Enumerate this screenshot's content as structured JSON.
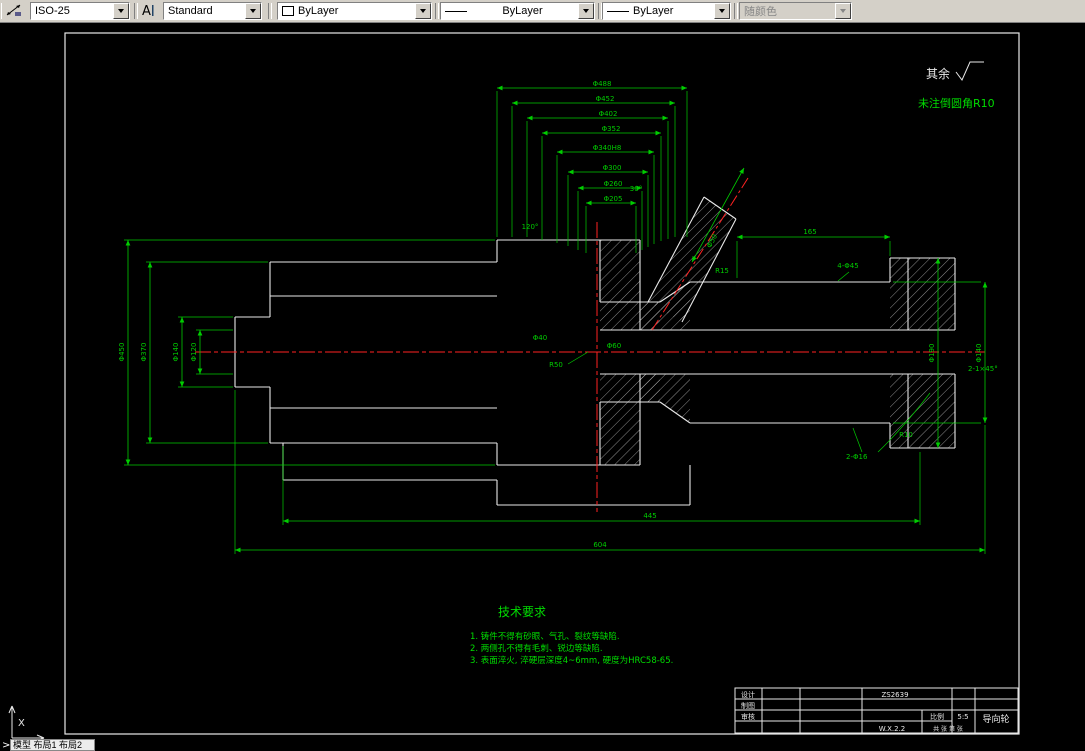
{
  "toolbar": {
    "dimstyle": "ISO-25",
    "textstyle": "Standard",
    "color": "ByLayer",
    "linetype": "ByLayer",
    "lineweight": "ByLayer",
    "plotstyle": "随颜色"
  },
  "tabs": {
    "text": "模型 布局1 布局2"
  },
  "canvas": {
    "prompt": ">",
    "ucs_x": "X"
  },
  "notes": {
    "rest": "其余",
    "fillet": "未注倒圆角R10"
  },
  "tech": {
    "title": "技术要求",
    "l1": "1. 铸件不得有砂眼、气孔、裂纹等缺陷.",
    "l2": "2. 两侧孔不得有毛刺、锐边等缺陷.",
    "l3": "3. 表面淬火, 淬硬层深度4~6mm, 硬度为HRC58-65."
  },
  "tb": {
    "design": "设计",
    "draft": "制图",
    "check": "审核",
    "code": "ZS2639",
    "scale_label": "比例",
    "scale": "5:5",
    "name": "导向轮",
    "dwgno": "W.X.2.2",
    "sheet": "共 张 第 张"
  },
  "dims": {
    "t0": "Φ488",
    "t1": "Φ452",
    "t2": "Φ402",
    "t3": "Φ352",
    "t4": "Φ340H8",
    "t5": "Φ300",
    "t6": "Φ260",
    "t7": "Φ205",
    "l0": "Φ450",
    "l1": "Φ370",
    "l2": "Φ140",
    "l3": "Φ120",
    "r0": "Φ190",
    "r1": "Φ140",
    "tr0": "165",
    "tr1": "4-Φ45",
    "tr2": "R15",
    "tr3": "120°",
    "tr4": "30°",
    "m0": "Φ60",
    "m1": "R50",
    "m2": "Φ40",
    "m3": "Φ50",
    "b0": "445",
    "b1": "604",
    "c0": "2-1×45°",
    "c1": "2-Φ16",
    "c2": "R10"
  },
  "colors": {
    "dimension": "#00cc00",
    "centerline": "#ff2222",
    "geometry": "#e8e8e8"
  }
}
